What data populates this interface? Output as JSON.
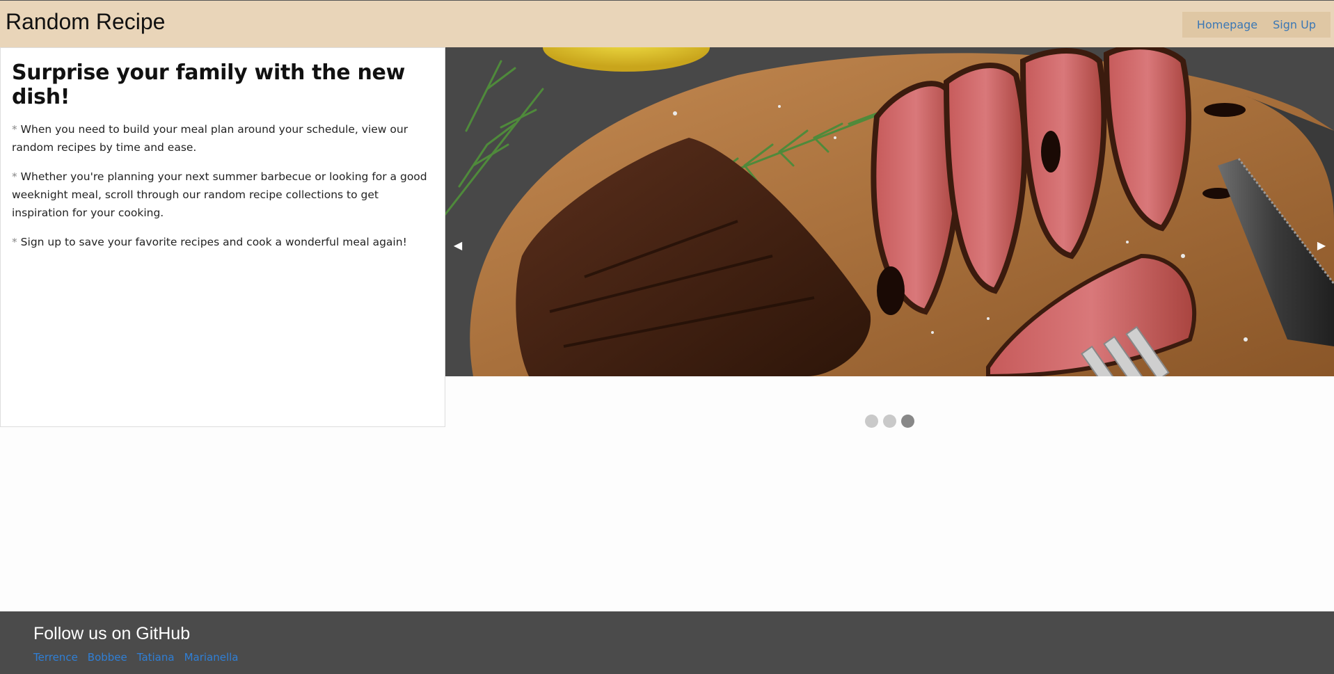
{
  "header": {
    "brand": "Random Recipe",
    "nav": [
      {
        "label": "Homepage"
      },
      {
        "label": "Sign Up"
      }
    ]
  },
  "intro": {
    "heading": "Surprise your family with the new dish!",
    "bullets": [
      {
        "marker": "*",
        "text": " When you need to build your meal plan around your schedule, view our random recipes by time and ease."
      },
      {
        "marker": "*",
        "text": " Whether you're planning your next summer barbecue or looking for a good weeknight meal, scroll through our random recipe collections to get inspiration for your cooking."
      },
      {
        "marker": "*",
        "text": " Sign up to save your favorite recipes and cook a wonderful meal again!"
      }
    ]
  },
  "carousel": {
    "prev_icon": "◀",
    "next_icon": "▶",
    "slide_count": 3,
    "active_slide": 3
  },
  "footer": {
    "title": "Follow us on GitHub",
    "links": [
      {
        "label": "Terrence"
      },
      {
        "label": "Bobbee"
      },
      {
        "label": "Tatiana"
      },
      {
        "label": "Marianella"
      }
    ]
  }
}
